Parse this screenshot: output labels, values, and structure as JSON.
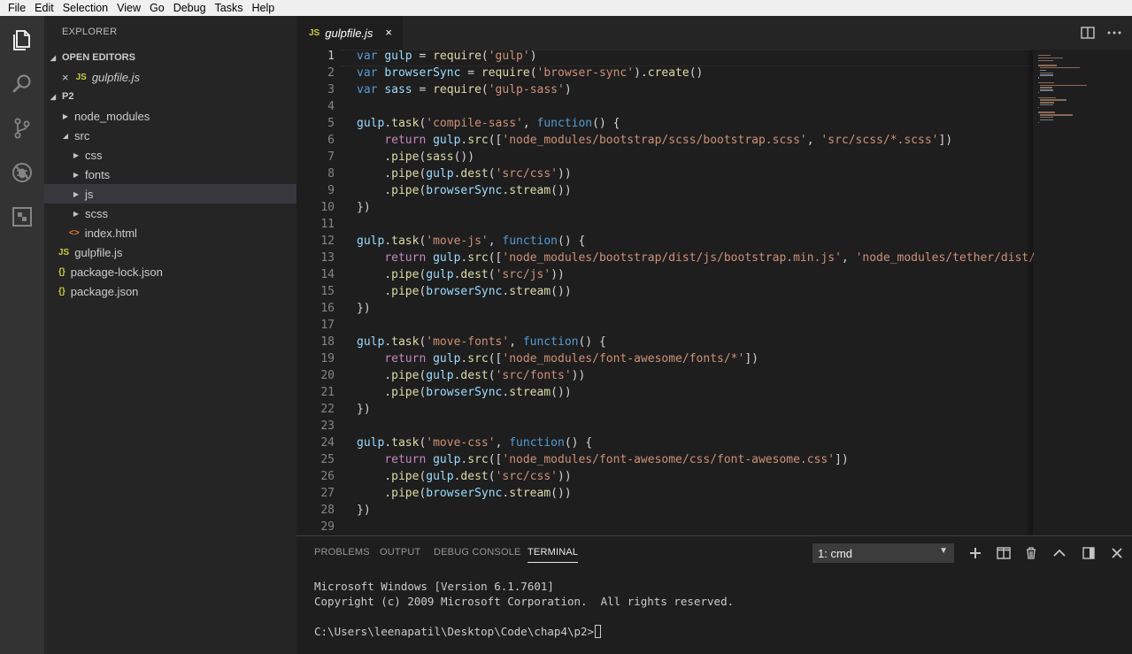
{
  "menu": [
    "File",
    "Edit",
    "Selection",
    "View",
    "Go",
    "Debug",
    "Tasks",
    "Help"
  ],
  "activity": {
    "icons": [
      "explorer-icon",
      "search-icon",
      "source-control-icon",
      "debug-icon",
      "extensions-icon"
    ]
  },
  "sidebar": {
    "title": "EXPLORER",
    "open_editors": {
      "header": "OPEN EDITORS",
      "items": [
        {
          "close": "×",
          "badge": "JS",
          "label": "gulpfile.js"
        }
      ]
    },
    "project": {
      "header": "P2",
      "tree": [
        {
          "label": "node_modules",
          "twisty": "▶",
          "badge": ""
        },
        {
          "label": "src",
          "twisty": "◢",
          "badge": ""
        },
        {
          "label": "css",
          "twisty": "▶",
          "badge": ""
        },
        {
          "label": "fonts",
          "twisty": "▶",
          "badge": ""
        },
        {
          "label": "js",
          "twisty": "▶",
          "badge": ""
        },
        {
          "label": "scss",
          "twisty": "▶",
          "badge": ""
        },
        {
          "label": "index.html",
          "twisty": "",
          "badge": "<>"
        },
        {
          "label": "gulpfile.js",
          "twisty": "",
          "badge": "JS"
        },
        {
          "label": "package-lock.json",
          "twisty": "",
          "badge": "{}"
        },
        {
          "label": "package.json",
          "twisty": "",
          "badge": "{}"
        }
      ]
    }
  },
  "tabs": [
    {
      "badge": "JS",
      "label": "gulpfile.js",
      "close": "×"
    }
  ],
  "editor": {
    "line_numbers": [
      "1",
      "2",
      "3",
      "4",
      "5",
      "6",
      "7",
      "8",
      "9",
      "10",
      "11",
      "12",
      "13",
      "14",
      "15",
      "16",
      "17",
      "18",
      "19",
      "20",
      "21",
      "22",
      "23",
      "24",
      "25",
      "26",
      "27",
      "28",
      "29"
    ],
    "lines": [
      "var gulp = require('gulp')",
      "var browserSync = require('browser-sync').create()",
      "var sass = require('gulp-sass')",
      "",
      "gulp.task('compile-sass', function() {",
      "    return gulp.src(['node_modules/bootstrap/scss/bootstrap.scss', 'src/scss/*.scss'])",
      "    .pipe(sass())",
      "    .pipe(gulp.dest('src/css'))",
      "    .pipe(browserSync.stream())",
      "})",
      "",
      "gulp.task('move-js', function() {",
      "    return gulp.src(['node_modules/bootstrap/dist/js/bootstrap.min.js', 'node_modules/tether/dist/js",
      "    .pipe(gulp.dest('src/js'))",
      "    .pipe(browserSync.stream())",
      "})",
      "",
      "gulp.task('move-fonts', function() {",
      "    return gulp.src(['node_modules/font-awesome/fonts/*'])",
      "    .pipe(gulp.dest('src/fonts'))",
      "    .pipe(browserSync.stream())",
      "})",
      "",
      "gulp.task('move-css', function() {",
      "    return gulp.src(['node_modules/font-awesome/css/font-awesome.css'])",
      "    .pipe(gulp.dest('src/css'))",
      "    .pipe(browserSync.stream())",
      "})",
      ""
    ]
  },
  "panel": {
    "tabs": [
      "PROBLEMS",
      "OUTPUT",
      "DEBUG CONSOLE",
      "TERMINAL"
    ],
    "active_tab": "TERMINAL",
    "terminal_select": "1: cmd",
    "terminal_lines": [
      "Microsoft Windows [Version 6.1.7601]",
      "Copyright (c) 2009 Microsoft Corporation.  All rights reserved.",
      "",
      "C:\\Users\\leenapatil\\Desktop\\Code\\chap4\\p2>"
    ]
  },
  "colors": {
    "keyword": "#569cd6",
    "string": "#ce9178",
    "function": "#dcdcaa",
    "variable": "#9cdcfe",
    "control": "#c586c0",
    "js_badge": "#cbcb41"
  }
}
